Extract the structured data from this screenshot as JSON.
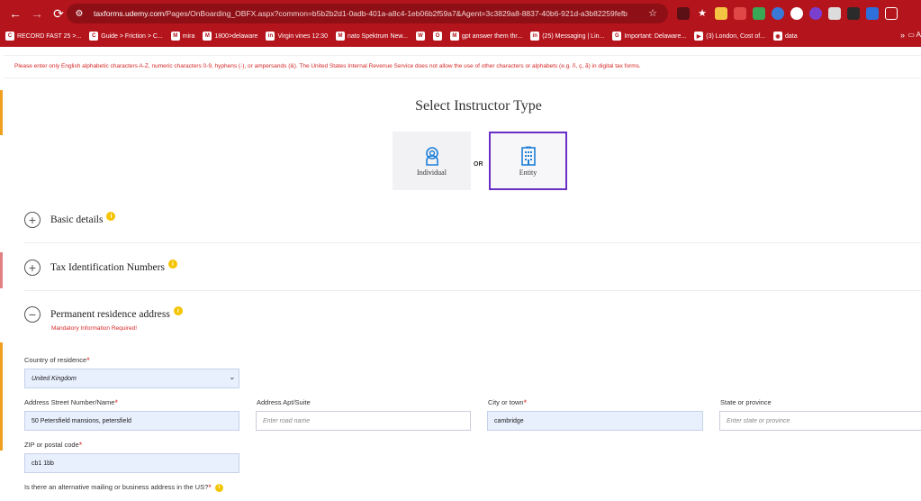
{
  "browser": {
    "url_host": "taxforms.udemy.com",
    "url_path": "/Pages/OnBoarding_OBFX.aspx?common=b5b2b2d1-0adb-401a-a8c4-1eb06b2f59a7&Agent=3c3829a8-8837-40b6-921d-a3b82259fefb",
    "bookmarks": [
      {
        "label": "RECORD FAST 25 >...",
        "icon": "C"
      },
      {
        "label": "Guide > Friction > C...",
        "icon": "C"
      },
      {
        "label": "mira",
        "icon": "M"
      },
      {
        "label": "1800>delaware",
        "icon": "M"
      },
      {
        "label": "Virgin vines 12:30",
        "icon": "in"
      },
      {
        "label": "nato Spektrum New...",
        "icon": "M"
      },
      {
        "label": "",
        "icon": "W"
      },
      {
        "label": "",
        "icon": "O"
      },
      {
        "label": "gpt answer them thr...",
        "icon": "M"
      },
      {
        "label": "(25) Messaging | Lin...",
        "icon": "in"
      },
      {
        "label": "Important: Delaware...",
        "icon": "G"
      },
      {
        "label": "(3) London, Cost of...",
        "icon": "▶"
      },
      {
        "label": "data",
        "icon": "◉"
      }
    ],
    "more": "»",
    "folder_label": "A"
  },
  "warning": "Please enter only English alphabetic characters A-Z, numeric characters 0-9, hyphens (-), or ampersands (&). The United States Internal Revenue Service does not allow the use of other characters or alphabets (e.g. ñ, ç, ã) in digital tax forms.",
  "page": {
    "title": "Select Instructor Type",
    "individual_label": "Individual",
    "or_label": "OR",
    "entity_label": "Entity"
  },
  "sections": {
    "basic": "Basic details",
    "tin": "Tax Identification Numbers",
    "address": "Permanent residence address",
    "mandatory": "Mandatory Information Required!",
    "expanded_icon": "−",
    "collapsed_icon": "+",
    "info_icon": "i"
  },
  "form": {
    "country_label": "Country of residence",
    "country_value": "United Kingdom",
    "street_label": "Address Street Number/Name",
    "street_value": "50 Petersfield mansions, petersfield",
    "apt_label": "Address Apt/Suite",
    "apt_placeholder": "Enter road name",
    "city_label": "City or town",
    "city_value": "cambridge",
    "state_label": "State or province",
    "state_placeholder": "Enter state or province",
    "zip_label": "ZIP or postal code",
    "zip_value": "cb1 1bb",
    "alt_question": "Is there an alternative mailing or business address in the US?",
    "required_mark": "*"
  },
  "colors": {
    "chrome": "#b4141c",
    "selected_border": "#6a2ec5",
    "warning_text": "#d62828",
    "info_dot": "#f5c400",
    "icon_blue": "#1e7fd8"
  }
}
